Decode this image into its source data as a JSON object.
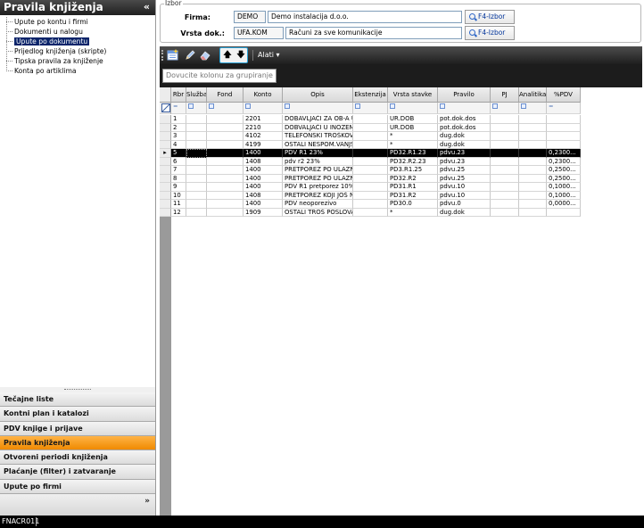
{
  "left_panel": {
    "title": "Pravila knjiženja",
    "collapse_glyph": "«",
    "tree": [
      {
        "label": "Upute po kontu i firmi",
        "selected": false
      },
      {
        "label": "Dokumenti u nalogu",
        "selected": false
      },
      {
        "label": "Upute po dokumentu",
        "selected": true
      },
      {
        "label": "Prijedlog knjiženja (skripte)",
        "selected": false
      },
      {
        "label": "Tipska pravila za knjiženje",
        "selected": false
      },
      {
        "label": "Konta po artiklima",
        "selected": false
      }
    ],
    "nav": [
      {
        "label": "Tečajne liste",
        "active": false
      },
      {
        "label": "Kontni plan i katalozi",
        "active": false
      },
      {
        "label": "PDV knjige i prijave",
        "active": false
      },
      {
        "label": "Pravila knjiženja",
        "active": true
      },
      {
        "label": "Otvoreni periodi knjiženja",
        "active": false
      },
      {
        "label": "Plaćanje (filter) i zatvaranje",
        "active": false
      },
      {
        "label": "Upute po firmi",
        "active": false
      }
    ],
    "more_glyph": "»"
  },
  "izbor": {
    "legend": "Izbor",
    "firma_label": "Firma:",
    "firma_code": "DEMO",
    "firma_name": "Demo instalacija d.o.o.",
    "firma_button": "F4-Izbor",
    "vrsta_label": "Vrsta dok.:",
    "vrsta_code": "UFA.KOM",
    "vrsta_name": "Računi za sve komunikacije",
    "vrsta_button": "F4-Izbor"
  },
  "toolbar": {
    "up_glyph": "🡅",
    "down_glyph": "🡇",
    "alati_label": "Alati ▾"
  },
  "group_hint": "Dovucite kolonu za grupiranje",
  "grid": {
    "columns": [
      "Rbr",
      "Služba",
      "Fond",
      "Konto",
      "Opis",
      "Ekstenzija",
      "Vrsta stavke",
      "Pravilo",
      "PJ",
      "Analitika",
      "%PDV"
    ],
    "filter_symbols": [
      "=",
      "A",
      "A",
      "A",
      "A",
      "A",
      "A",
      "A",
      "A",
      "A",
      "="
    ],
    "selected_row": 5,
    "selected_marker": "▸",
    "rows": [
      [
        "1",
        "",
        "",
        "2201",
        "DOBAVLJAČI ZA OB-A U...",
        "",
        "UR.DOB",
        "pot.dok.dos",
        "",
        "",
        ""
      ],
      [
        "2",
        "",
        "",
        "2210",
        "DOBVALJAČI  U INOZEM...",
        "",
        "UR.DOB",
        "pot.dok.dos",
        "",
        "",
        ""
      ],
      [
        "3",
        "",
        "",
        "4102",
        "TELEFONSKI TROŠKOVI",
        "",
        "*",
        "dug.dok",
        "",
        "",
        ""
      ],
      [
        "4",
        "",
        "",
        "4199",
        "OSTALI NESPOM.VANJSK...",
        "",
        "*",
        "dug.dok",
        "",
        "",
        ""
      ],
      [
        "5",
        "",
        "",
        "1400",
        "PDV R1 23%",
        "",
        "PD32.R1.23",
        "pdvu.23",
        "",
        "",
        "0,2300..."
      ],
      [
        "6",
        "",
        "",
        "1408",
        "pdv r2 23%",
        "",
        "PD32.R2.23",
        "pdvu.23",
        "",
        "",
        "0,2300..."
      ],
      [
        "7",
        "",
        "",
        "1400",
        "PRETPOREZ PO ULAZNIM...",
        "",
        "PD3.R1.25",
        "pdvu.25",
        "",
        "",
        "0,2500..."
      ],
      [
        "8",
        "",
        "",
        "1400",
        "PRETPOREZ PO ULAZNIM...",
        "",
        "PD32.R2",
        "pdvu.25",
        "",
        "",
        "0,2500..."
      ],
      [
        "9",
        "",
        "",
        "1400",
        "PDV R1 pretporez 10%",
        "",
        "PD31.R1",
        "pdvu.10",
        "",
        "",
        "0,1000..."
      ],
      [
        "10",
        "",
        "",
        "1408",
        "PRETPOREZ KOJI JOŠ NI...",
        "",
        "PD31.R2",
        "pdvu.10",
        "",
        "",
        "0,1000..."
      ],
      [
        "11",
        "",
        "",
        "1400",
        "PDV neoporezivo",
        "",
        "PD30.0",
        "pdvu.0",
        "",
        "",
        "0,0000..."
      ],
      [
        "12",
        "",
        "",
        "1909",
        "OSTALI TROŠ POSLOVAN...",
        "",
        "*",
        "dug.dok",
        "",
        "",
        ""
      ]
    ]
  },
  "statusbar": {
    "code": "FNACR011"
  },
  "colors": {
    "header_dark": "#1f1f1f",
    "nav_active": "#f08a00",
    "selection": "#0a246a",
    "row_selected": "#000000",
    "toolbar_highlight": "#2aa3d8"
  }
}
